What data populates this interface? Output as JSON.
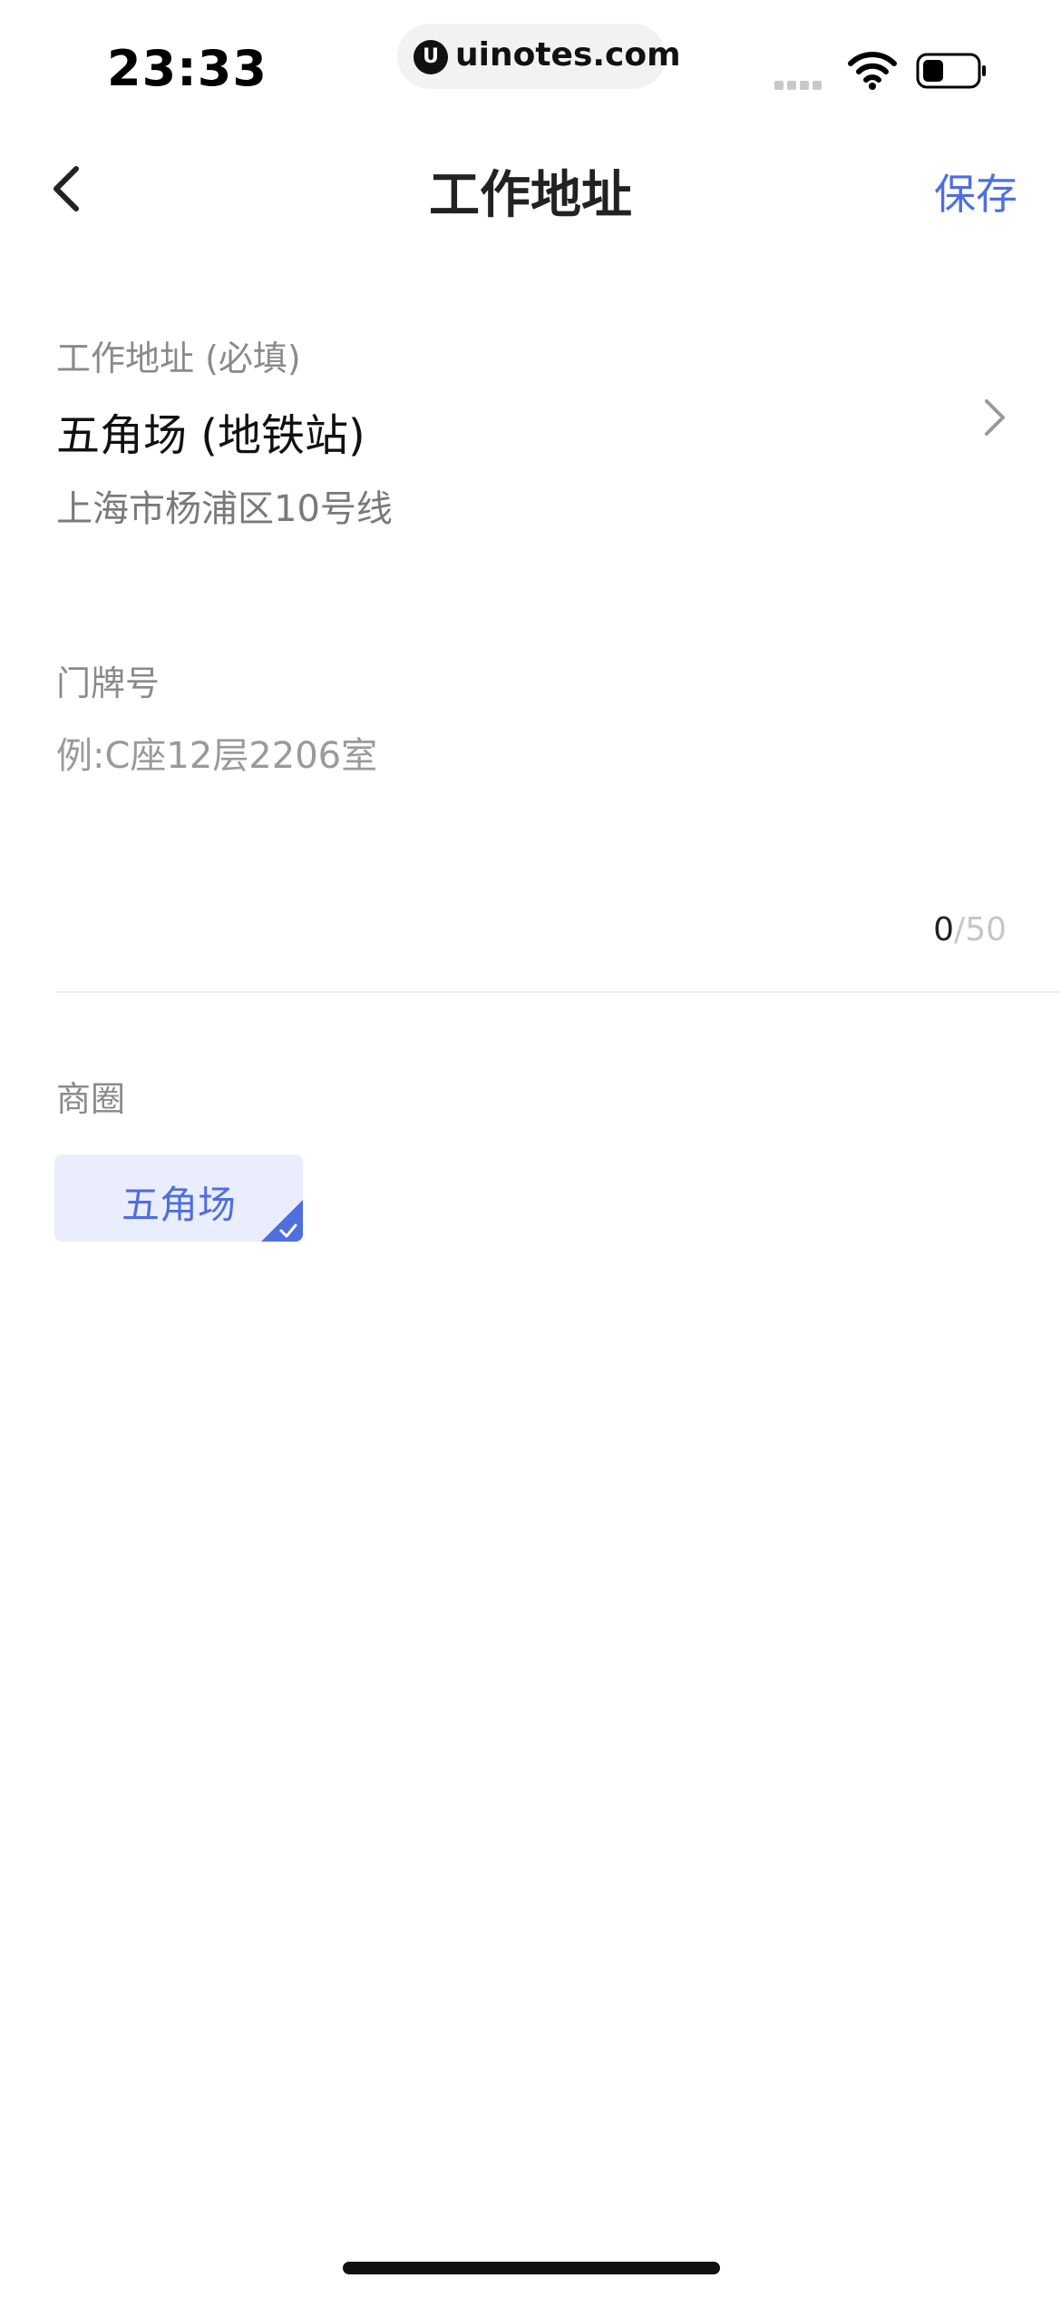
{
  "status_bar": {
    "time": "23:33",
    "url": "uinotes.com",
    "url_logo_glyph": "U"
  },
  "nav": {
    "title": "工作地址",
    "save_label": "保存",
    "accent_color": "#4f6ee0"
  },
  "work_address": {
    "label": "工作地址 (必填)",
    "name": "五角场 (地铁站)",
    "detail": "上海市杨浦区10号线"
  },
  "door_number": {
    "label": "门牌号",
    "placeholder": "例:C座12层2206室",
    "value": "",
    "count": "0",
    "separator": "/",
    "max": "50"
  },
  "business_area": {
    "label": "商圈",
    "chips": [
      {
        "label": "五角场",
        "selected": true
      }
    ]
  },
  "icons": {
    "back": "chevron-left-icon",
    "address_arrow": "chevron-right-icon",
    "chip_selected": "checkmark-corner-icon",
    "wifi": "wifi-icon",
    "battery": "battery-icon"
  }
}
